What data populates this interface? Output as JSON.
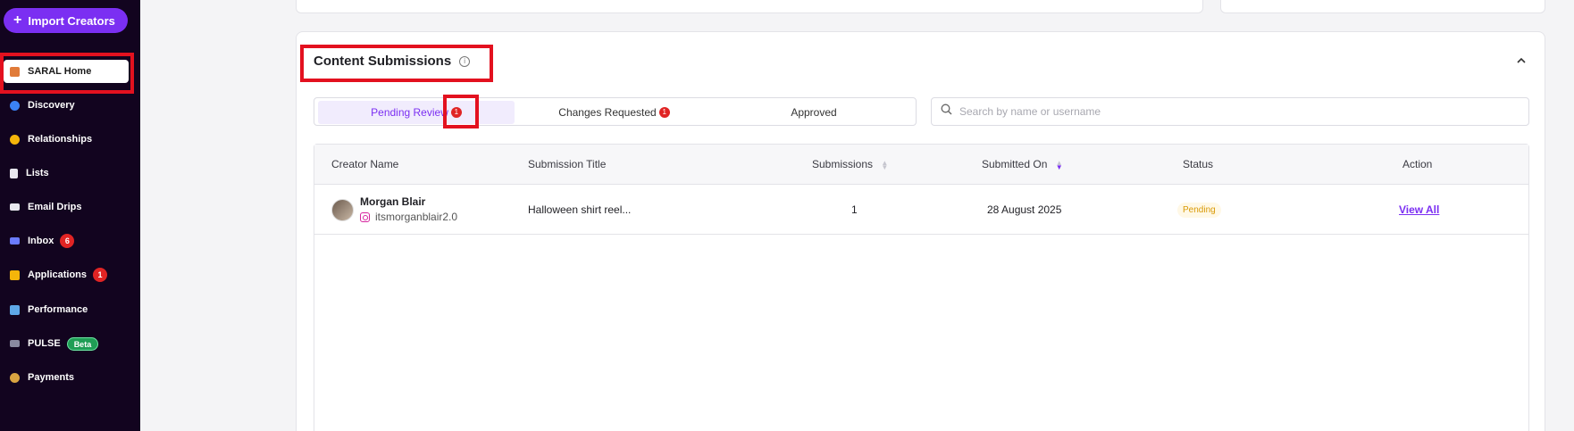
{
  "sidebar": {
    "import_label": "Import Creators",
    "items": [
      {
        "label": "SARAL Home",
        "icon": "house-icon"
      },
      {
        "label": "Discovery",
        "icon": "magnifier-icon"
      },
      {
        "label": "Relationships",
        "icon": "handshake-icon"
      },
      {
        "label": "Lists",
        "icon": "document-icon"
      },
      {
        "label": "Email Drips",
        "icon": "email-icon"
      },
      {
        "label": "Inbox",
        "icon": "inbox-icon",
        "badge": "6"
      },
      {
        "label": "Applications",
        "icon": "applications-icon",
        "badge": "1"
      },
      {
        "label": "Performance",
        "icon": "chart-icon"
      },
      {
        "label": "PULSE",
        "icon": "laptop-icon",
        "tag": "Beta"
      },
      {
        "label": "Payments",
        "icon": "money-bag-icon"
      }
    ]
  },
  "panel": {
    "title": "Content Submissions",
    "tabs": [
      {
        "label": "Pending Review",
        "badge": "1"
      },
      {
        "label": "Changes Requested",
        "badge": "1"
      },
      {
        "label": "Approved"
      }
    ],
    "search_placeholder": "Search by name or username"
  },
  "table": {
    "headers": [
      "Creator Name",
      "Submission Title",
      "Submissions",
      "Submitted On",
      "Status",
      "Action"
    ],
    "rows": [
      {
        "name": "Morgan Blair",
        "username": "itsmorganblair2.0",
        "title": "Halloween shirt reel...",
        "submissions": "1",
        "submitted_on": "28 August 2025",
        "status": "Pending",
        "action": "View All"
      }
    ]
  },
  "colors": {
    "sidebar_bg": "#12041f",
    "accent": "#7b2ff2",
    "badge": "#e02424",
    "beta": "#1f9d55",
    "pending": "#d99a06",
    "highlight_box": "#e3111f"
  }
}
